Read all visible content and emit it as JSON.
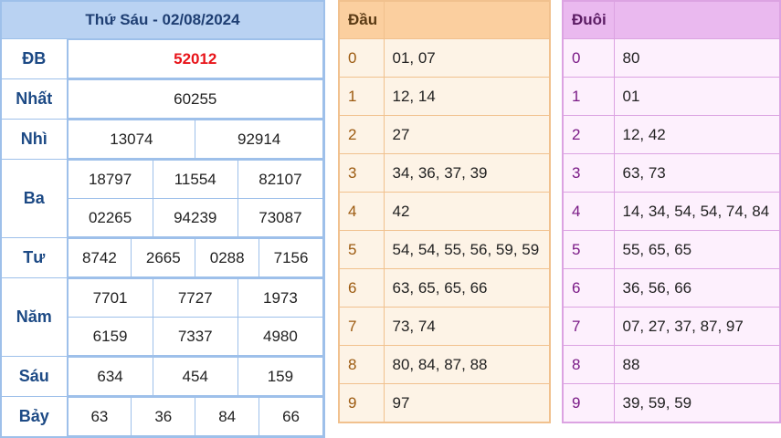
{
  "results": {
    "title": "Thứ Sáu - 02/08/2024",
    "rows": [
      {
        "label": "ĐB",
        "lines": [
          [
            "52012"
          ]
        ],
        "special": true
      },
      {
        "label": "Nhất",
        "lines": [
          [
            "60255"
          ]
        ]
      },
      {
        "label": "Nhì",
        "lines": [
          [
            "13074",
            "92914"
          ]
        ]
      },
      {
        "label": "Ba",
        "lines": [
          [
            "18797",
            "11554",
            "82107"
          ],
          [
            "02265",
            "94239",
            "73087"
          ]
        ]
      },
      {
        "label": "Tư",
        "lines": [
          [
            "8742",
            "2665",
            "0288",
            "7156"
          ]
        ]
      },
      {
        "label": "Năm",
        "lines": [
          [
            "7701",
            "7727",
            "1973"
          ],
          [
            "6159",
            "7337",
            "4980"
          ]
        ]
      },
      {
        "label": "Sáu",
        "lines": [
          [
            "634",
            "454",
            "159"
          ]
        ]
      },
      {
        "label": "Bảy",
        "lines": [
          [
            "63",
            "36",
            "84",
            "66"
          ]
        ]
      }
    ]
  },
  "head_table": {
    "title": "Đầu",
    "rows": [
      {
        "digit": "0",
        "values": "01, 07"
      },
      {
        "digit": "1",
        "values": "12, 14"
      },
      {
        "digit": "2",
        "values": "27"
      },
      {
        "digit": "3",
        "values": "34, 36, 37, 39"
      },
      {
        "digit": "4",
        "values": "42"
      },
      {
        "digit": "5",
        "values": "54, 54, 55, 56, 59, 59"
      },
      {
        "digit": "6",
        "values": "63, 65, 65, 66"
      },
      {
        "digit": "7",
        "values": "73, 74"
      },
      {
        "digit": "8",
        "values": "80, 84, 87, 88"
      },
      {
        "digit": "9",
        "values": "97"
      }
    ]
  },
  "tail_table": {
    "title": "Đuôi",
    "rows": [
      {
        "digit": "0",
        "values": "80"
      },
      {
        "digit": "1",
        "values": "01"
      },
      {
        "digit": "2",
        "values": "12, 42"
      },
      {
        "digit": "3",
        "values": "63, 73"
      },
      {
        "digit": "4",
        "values": "14, 34, 54, 54, 74, 84"
      },
      {
        "digit": "5",
        "values": "55, 65, 65"
      },
      {
        "digit": "6",
        "values": "36, 56, 66"
      },
      {
        "digit": "7",
        "values": "07, 27, 37, 87, 97"
      },
      {
        "digit": "8",
        "values": "88"
      },
      {
        "digit": "9",
        "values": "39, 59, 59"
      }
    ]
  }
}
